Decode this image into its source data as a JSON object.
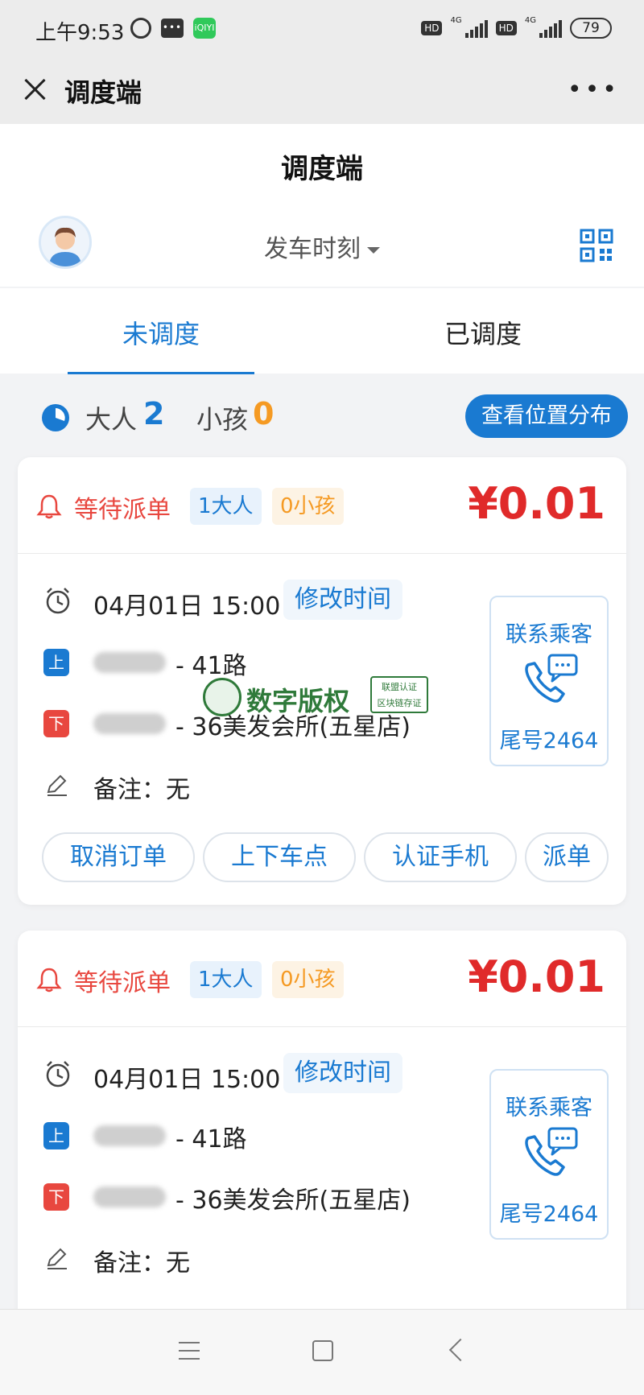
{
  "status_bar": {
    "time": "上午9:53",
    "network": "4G",
    "hd": "HD",
    "battery": "79",
    "app_icon": "iQIYI"
  },
  "titlebar": {
    "title": "调度端"
  },
  "page": {
    "title": "调度端",
    "departure_dropdown": "发车时刻"
  },
  "tabs": [
    {
      "label": "未调度",
      "active": true
    },
    {
      "label": "已调度",
      "active": false
    }
  ],
  "summary": {
    "adult_label": "大人",
    "adult_count": "2",
    "child_label": "小孩",
    "child_count": "0",
    "location_button": "查看位置分布"
  },
  "orders": [
    {
      "status": "等待派单",
      "adult_tag": "1大人",
      "child_tag": "0小孩",
      "price": "¥0.01",
      "datetime": "04月01日 15:00",
      "edit_time": "修改时间",
      "pickup_badge": "上",
      "pickup_route": "- 41路",
      "dropoff_badge": "下",
      "dropoff_route": "- 36美发会所(五星店)",
      "note": "备注：无",
      "contact_label": "联系乘客",
      "tail_number": "尾号2464",
      "actions": [
        "取消订单",
        "上下车点",
        "认证手机",
        "派单"
      ]
    },
    {
      "status": "等待派单",
      "adult_tag": "1大人",
      "child_tag": "0小孩",
      "price": "¥0.01",
      "datetime": "04月01日 15:00",
      "edit_time": "修改时间",
      "pickup_badge": "上",
      "pickup_route": "- 41路",
      "dropoff_badge": "下",
      "dropoff_route": "- 36美发会所(五星店)",
      "note": "备注：无",
      "contact_label": "联系乘客",
      "tail_number": "尾号2464"
    }
  ],
  "watermark": {
    "text": "数字版权",
    "stamp_line1": "联盟认证",
    "stamp_line2": "区块链存证"
  },
  "colors": {
    "accent": "#1a7ad1",
    "danger": "#e8473f",
    "price": "#e02a2a",
    "child": "#f59a23"
  }
}
